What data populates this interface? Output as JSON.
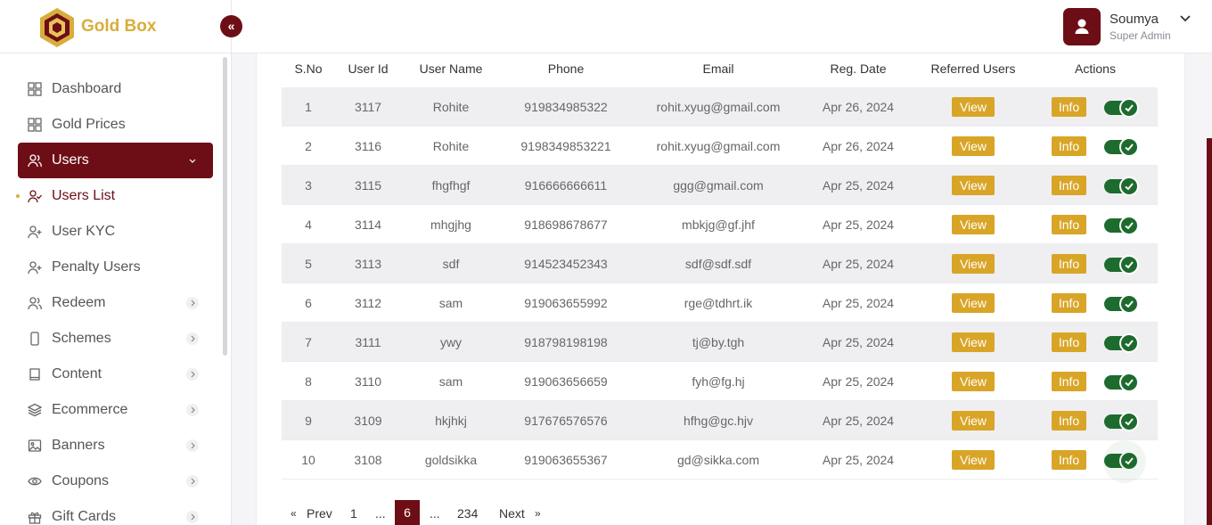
{
  "header": {
    "brand_name": "Gold Box",
    "collapse_glyph": "«",
    "user_name": "Soumya",
    "user_role": "Super Admin"
  },
  "sidebar": {
    "items": [
      {
        "label": "Dashboard",
        "icon": "grid-icon"
      },
      {
        "label": "Gold Prices",
        "icon": "grid-icon"
      },
      {
        "label": "Users",
        "icon": "users-icon",
        "active": true
      },
      {
        "label": "Users List",
        "icon": "user-check-icon",
        "current": true
      },
      {
        "label": "User KYC",
        "icon": "user-plus-icon"
      },
      {
        "label": "Penalty Users",
        "icon": "user-plus-icon"
      },
      {
        "label": "Redeem",
        "icon": "users-icon"
      },
      {
        "label": "Schemes",
        "icon": "phone-icon"
      },
      {
        "label": "Content",
        "icon": "book-icon"
      },
      {
        "label": "Ecommerce",
        "icon": "layers-icon"
      },
      {
        "label": "Banners",
        "icon": "image-icon"
      },
      {
        "label": "Coupons",
        "icon": "eye-icon"
      },
      {
        "label": "Gift Cards",
        "icon": "gift-icon"
      }
    ]
  },
  "table": {
    "headers": [
      "S.No",
      "User Id",
      "User Name",
      "Phone",
      "Email",
      "Reg. Date",
      "Referred Users",
      "Actions"
    ],
    "view_label": "View",
    "info_label": "Info",
    "rows": [
      {
        "sno": "1",
        "user_id": "3117",
        "name": "Rohite",
        "phone": "919834985322",
        "email": "rohit.xyug@gmail.com",
        "date": "Apr 26, 2024",
        "active": true
      },
      {
        "sno": "2",
        "user_id": "3116",
        "name": "Rohite",
        "phone": "9198349853221",
        "email": "rohit.xyug@gmail.com",
        "date": "Apr 26, 2024",
        "active": true
      },
      {
        "sno": "3",
        "user_id": "3115",
        "name": "fhgfhgf",
        "phone": "916666666611",
        "email": "ggg@gmail.com",
        "date": "Apr 25, 2024",
        "active": true
      },
      {
        "sno": "4",
        "user_id": "3114",
        "name": "mhgjhg",
        "phone": "918698678677",
        "email": "mbkjg@gf.jhf",
        "date": "Apr 25, 2024",
        "active": true
      },
      {
        "sno": "5",
        "user_id": "3113",
        "name": "sdf",
        "phone": "914523452343",
        "email": "sdf@sdf.sdf",
        "date": "Apr 25, 2024",
        "active": true
      },
      {
        "sno": "6",
        "user_id": "3112",
        "name": "sam",
        "phone": "919063655992",
        "email": "rge@tdhrt.ik",
        "date": "Apr 25, 2024",
        "active": true
      },
      {
        "sno": "7",
        "user_id": "3111",
        "name": "ywy",
        "phone": "918798198198",
        "email": "tj@by.tgh",
        "date": "Apr 25, 2024",
        "active": true
      },
      {
        "sno": "8",
        "user_id": "3110",
        "name": "sam",
        "phone": "919063656659",
        "email": "fyh@fg.hj",
        "date": "Apr 25, 2024",
        "active": true
      },
      {
        "sno": "9",
        "user_id": "3109",
        "name": "hkjhkj",
        "phone": "917676576576",
        "email": "hfhg@gc.hjv",
        "date": "Apr 25, 2024",
        "active": true
      },
      {
        "sno": "10",
        "user_id": "3108",
        "name": "goldsikka",
        "phone": "919063655367",
        "email": "gd@sikka.com",
        "date": "Apr 25, 2024",
        "active": true
      }
    ]
  },
  "pagination": {
    "prev_arrow": "«",
    "prev_label": "Prev",
    "first": "1",
    "ellipsis": "...",
    "current": "6",
    "last": "234",
    "next_label": "Next",
    "next_arrow": "»"
  },
  "colors": {
    "brand_maroon": "#6d0e17",
    "gold": "#d9ad3c",
    "button_gold": "#d9a527",
    "toggle_green": "#1d6b2e"
  }
}
